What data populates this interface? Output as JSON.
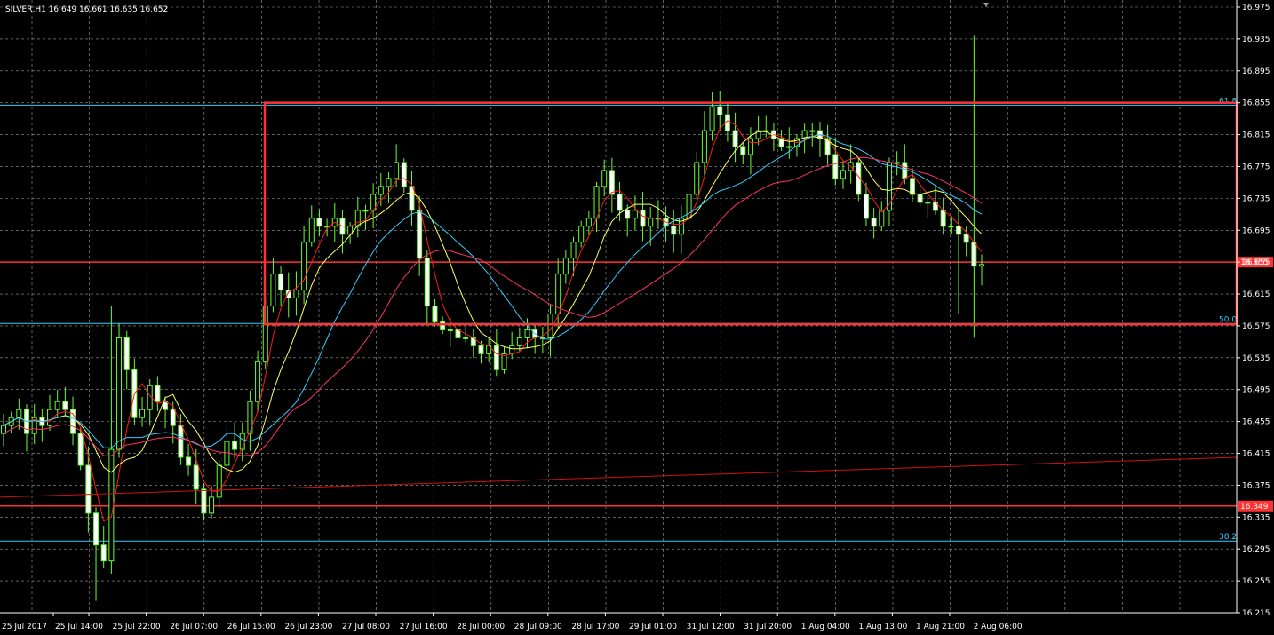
{
  "chart_title": "SILVER,H1  16.649 16.661 16.635 16.652",
  "colors": {
    "background": "#000000",
    "grid": "#9a9a9a",
    "bull": "#66ff33",
    "bear": "#ffffff",
    "ma_red": "#ff1a1a",
    "ma_yellow": "#ffff66",
    "ma_cyan": "#33ccff",
    "ma_pink": "#ff3366",
    "ma_long": "#cc1111",
    "box": "#ff3333",
    "fib": "#33ccff"
  },
  "chart_data": {
    "type": "candlestick",
    "symbol": "SILVER",
    "timeframe": "H1",
    "ohlc_header": {
      "open": 16.649,
      "high": 16.661,
      "low": 16.635,
      "close": 16.652
    },
    "ylim": [
      16.215,
      16.975
    ],
    "y_ticks": [
      "16.975",
      "16.935",
      "16.895",
      "16.855",
      "16.815",
      "16.775",
      "16.735",
      "16.695",
      "16.655",
      "16.615",
      "16.575",
      "16.535",
      "16.495",
      "16.455",
      "16.415",
      "16.375",
      "16.335",
      "16.295",
      "16.255",
      "16.215"
    ],
    "x_ticks": [
      "25 Jul 2017",
      "25 Jul 14:00",
      "25 Jul 22:00",
      "26 Jul 07:00",
      "26 Jul 15:00",
      "26 Jul 23:00",
      "27 Jul 08:00",
      "27 Jul 16:00",
      "28 Jul 00:00",
      "28 Jul 09:00",
      "28 Jul 17:00",
      "29 Jul 01:00",
      "31 Jul 12:00",
      "31 Jul 20:00",
      "1 Aug 04:00",
      "1 Aug 13:00",
      "1 Aug 21:00",
      "2 Aug 06:00"
    ],
    "close_path": [
      16.45,
      16.46,
      16.47,
      16.44,
      16.46,
      16.45,
      16.47,
      16.48,
      16.47,
      16.44,
      16.4,
      16.34,
      16.3,
      16.28,
      16.42,
      16.56,
      16.52,
      16.46,
      16.47,
      16.5,
      16.48,
      16.47,
      16.45,
      16.41,
      16.4,
      16.37,
      16.34,
      16.36,
      16.4,
      16.43,
      16.42,
      16.44,
      16.48,
      16.53,
      16.6,
      16.64,
      16.62,
      16.61,
      16.62,
      16.68,
      16.71,
      16.7,
      16.7,
      16.71,
      16.69,
      16.7,
      16.72,
      16.72,
      16.74,
      16.75,
      16.76,
      16.78,
      16.75,
      16.72,
      16.66,
      16.6,
      16.58,
      16.57,
      16.57,
      16.56,
      16.56,
      16.55,
      16.54,
      16.55,
      16.52,
      16.54,
      16.55,
      16.56,
      16.57,
      16.56,
      16.56,
      16.59,
      16.64,
      16.66,
      16.68,
      16.7,
      16.71,
      16.75,
      16.77,
      16.74,
      16.72,
      16.71,
      16.72,
      16.7,
      16.71,
      16.71,
      16.7,
      16.69,
      16.71,
      16.74,
      16.78,
      16.82,
      16.85,
      16.84,
      16.82,
      16.8,
      16.79,
      16.81,
      16.82,
      16.82,
      16.81,
      16.8,
      16.8,
      16.81,
      16.82,
      16.82,
      16.81,
      16.79,
      16.76,
      16.77,
      16.78,
      16.74,
      16.71,
      16.7,
      16.72,
      16.78,
      16.78,
      16.76,
      16.74,
      16.73,
      16.73,
      16.72,
      16.7,
      16.7,
      16.69,
      16.68,
      16.65,
      16.652
    ],
    "price_levels": [
      {
        "label": "16.655",
        "value": 16.655
      },
      {
        "label": "16.349",
        "value": 16.349
      }
    ],
    "fib_levels": [
      {
        "label": "61.8",
        "value": 16.852
      },
      {
        "label": "50.0",
        "value": 16.578
      },
      {
        "label": "38.2",
        "value": 16.305
      }
    ],
    "box": {
      "x_start": "26 Jul 22:00",
      "price_top": 16.855,
      "price_bottom": 16.577
    }
  }
}
